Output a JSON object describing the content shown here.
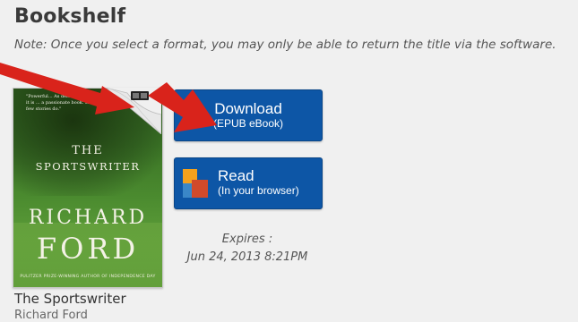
{
  "page": {
    "heading": "Bookshelf",
    "note": "Note: Once you select a format, you may only be able to return the title via the software."
  },
  "book": {
    "cover": {
      "blurb": "\"Powerful... As deft and persuasive as it is ... a passionate book. It does what few stories do.\"",
      "title_line1": "THE",
      "title_line2": "SPORTSWRITER",
      "author_line1": "RICHARD",
      "author_line2": "FORD",
      "tagline": "PULITZER PRIZE-WINNING AUTHOR OF INDEPENDENCE DAY"
    },
    "title": "The Sportswriter",
    "author": "Richard Ford"
  },
  "actions": {
    "download": {
      "label": "Download",
      "format": "(EPUB eBook)"
    },
    "read": {
      "label": "Read",
      "sublabel": "(In your browser)",
      "icon": "read-in-browser-icon"
    }
  },
  "loan": {
    "expires_label": "Expires :",
    "expires_date": "Jun 24, 2013 8:21PM"
  },
  "colors": {
    "button_blue": "#0d56a6",
    "arrow_red": "#d9231b",
    "background": "#f0f0f0"
  }
}
